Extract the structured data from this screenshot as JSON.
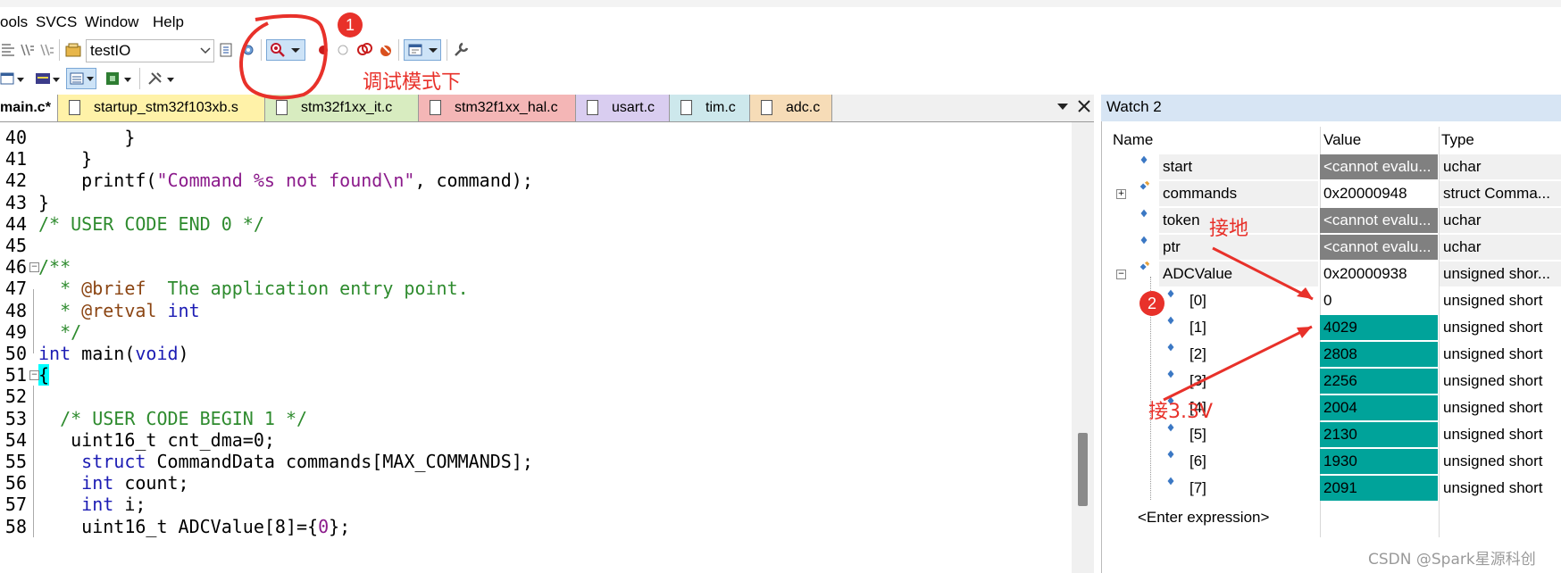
{
  "menu": {
    "items": [
      "ools",
      "SVCS",
      "Window",
      "Help"
    ]
  },
  "toolbar1": {
    "target_combo": "testIO"
  },
  "tabs": [
    {
      "label": "main.c*",
      "bg": "#ffffff",
      "active": true
    },
    {
      "label": "startup_stm32f103xb.s",
      "bg": "#fff2a8"
    },
    {
      "label": "stm32f1xx_it.c",
      "bg": "#d8ecc0"
    },
    {
      "label": "stm32f1xx_hal.c",
      "bg": "#f4b6b6"
    },
    {
      "label": "usart.c",
      "bg": "#d9cdf0"
    },
    {
      "label": "tim.c",
      "bg": "#cde8ec"
    },
    {
      "label": "adc.c",
      "bg": "#f6dcb7"
    }
  ],
  "editor": {
    "lines": [
      {
        "num": "40",
        "code": "        }"
      },
      {
        "num": "41",
        "code": "    }"
      },
      {
        "num": "42",
        "code": "    printf(\"Command %s not found\\n\", command);"
      },
      {
        "num": "43",
        "code": "}"
      },
      {
        "num": "44",
        "code": "/* USER CODE END 0 */"
      },
      {
        "num": "45",
        "code": ""
      },
      {
        "num": "46",
        "code": "/**"
      },
      {
        "num": "47",
        "code": "  * @brief  The application entry point."
      },
      {
        "num": "48",
        "code": "  * @retval int"
      },
      {
        "num": "49",
        "code": "  */"
      },
      {
        "num": "50",
        "code": "int main(void)"
      },
      {
        "num": "51",
        "code": "{"
      },
      {
        "num": "52",
        "code": ""
      },
      {
        "num": "53",
        "code": "  /* USER CODE BEGIN 1 */"
      },
      {
        "num": "54",
        "code": "   uint16_t cnt_dma=0;"
      },
      {
        "num": "55",
        "code": "    struct CommandData commands[MAX_COMMANDS];"
      },
      {
        "num": "56",
        "code": "    int count;"
      },
      {
        "num": "57",
        "code": "    int i;"
      },
      {
        "num": "58",
        "code": "    uint16_t ADCValue[8]={0};"
      }
    ]
  },
  "watch": {
    "title": "Watch 2",
    "headers": {
      "name": "Name",
      "value": "Value",
      "type": "Type"
    },
    "rows": [
      {
        "name": "start",
        "value": "<cannot evalu...",
        "type": "uchar",
        "state": "error"
      },
      {
        "name": "commands",
        "value": "0x20000948",
        "type": "struct Comma...",
        "state": "normal",
        "expand": "+"
      },
      {
        "name": "token",
        "value": "<cannot evalu...",
        "type": "uchar",
        "state": "error"
      },
      {
        "name": "ptr",
        "value": "<cannot evalu...",
        "type": "uchar",
        "state": "error"
      },
      {
        "name": "ADCValue",
        "value": "0x20000938",
        "type": "unsigned shor...",
        "state": "normal",
        "expand": "-"
      },
      {
        "name": "[0]",
        "value": "0",
        "type": "unsigned short",
        "state": "normal",
        "child": true
      },
      {
        "name": "[1]",
        "value": "4029",
        "type": "unsigned short",
        "state": "changed",
        "child": true
      },
      {
        "name": "[2]",
        "value": "2808",
        "type": "unsigned short",
        "state": "changed",
        "child": true
      },
      {
        "name": "[3]",
        "value": "2256",
        "type": "unsigned short",
        "state": "changed",
        "child": true
      },
      {
        "name": "[4]",
        "value": "2004",
        "type": "unsigned short",
        "state": "changed",
        "child": true
      },
      {
        "name": "[5]",
        "value": "2130",
        "type": "unsigned short",
        "state": "changed",
        "child": true
      },
      {
        "name": "[6]",
        "value": "1930",
        "type": "unsigned short",
        "state": "changed",
        "child": true
      },
      {
        "name": "[7]",
        "value": "2091",
        "type": "unsigned short",
        "state": "changed",
        "child": true
      }
    ],
    "enter_expression": "<Enter expression>"
  },
  "annotations": {
    "badge1": "1",
    "badge2": "2",
    "debug_mode": "调试模式下",
    "ground": "接地",
    "v33": "接3.3V",
    "color": "#e8312a"
  },
  "watermark": "CSDN @Spark星源科创",
  "colors": {
    "changed_bg": "#00a39a",
    "error_bg": "#808080",
    "error_text": "#ffffff"
  }
}
